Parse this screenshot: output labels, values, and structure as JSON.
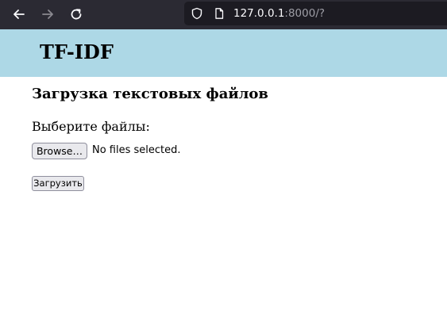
{
  "browser": {
    "url_host": "127.0.0.1",
    "url_rest": ":8000/?",
    "icons": {
      "back": "arrow-left-icon",
      "forward": "arrow-right-icon",
      "reload": "reload-icon",
      "security": "shield-icon",
      "page": "document-icon"
    },
    "colors": {
      "toolbar": "#2b2a33",
      "urlbar": "#1c1b22"
    }
  },
  "header": {
    "title": "TF-IDF",
    "background": "#add8e6"
  },
  "main": {
    "section_title": "Загрузка текстовых файлов",
    "files_label": "Выберите файлы:",
    "browse_button": "Browse…",
    "no_files_text": "No files selected.",
    "upload_button": "Загрузить"
  }
}
